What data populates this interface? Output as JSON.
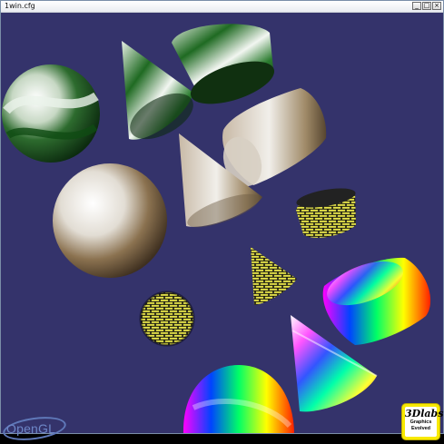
{
  "window": {
    "title": "1win.cfg",
    "buttons": {
      "minimize": "_",
      "maximize": "□",
      "close": "×"
    }
  },
  "branding": {
    "opengl": "OpenGL",
    "logo_3d_mark": "3Dlabs",
    "logo_3d_tagline_1": "Graphics",
    "logo_3d_tagline_2": "Evolved"
  },
  "scene": {
    "background": "#34336b",
    "objects": [
      {
        "name": "green-sphere",
        "kind": "sphere",
        "texture": "green-marble"
      },
      {
        "name": "green-cone",
        "kind": "cone",
        "texture": "green-marble"
      },
      {
        "name": "green-cylinder",
        "kind": "cylinder",
        "texture": "green-marble"
      },
      {
        "name": "tan-cylinder",
        "kind": "cylinder",
        "texture": "tan-marble"
      },
      {
        "name": "tan-cone",
        "kind": "cone",
        "texture": "tan-marble"
      },
      {
        "name": "tan-sphere",
        "kind": "sphere",
        "texture": "tan-marble"
      },
      {
        "name": "brick-cylinder",
        "kind": "cylinder",
        "texture": "yellow-brick"
      },
      {
        "name": "brick-cone",
        "kind": "cone",
        "texture": "yellow-brick"
      },
      {
        "name": "brick-sphere",
        "kind": "sphere",
        "texture": "yellow-brick"
      },
      {
        "name": "rainbow-cylinder",
        "kind": "cylinder",
        "texture": "rainbow"
      },
      {
        "name": "rainbow-cone",
        "kind": "cone",
        "texture": "rainbow"
      },
      {
        "name": "rainbow-sphere",
        "kind": "sphere",
        "texture": "rainbow"
      }
    ]
  }
}
